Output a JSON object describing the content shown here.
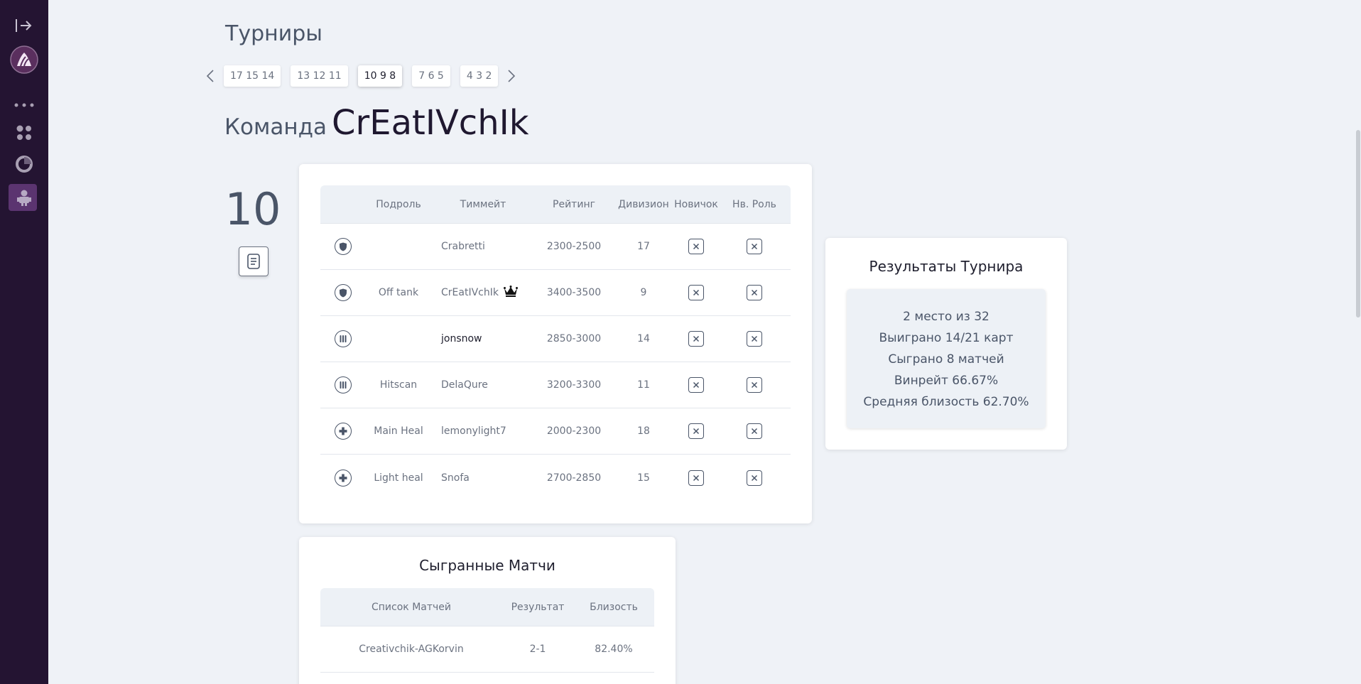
{
  "page": {
    "title": "Турниры"
  },
  "pager": {
    "pages": [
      "17 15 14",
      "13 12 11",
      "10 9 8",
      "7 6 5",
      "4 3 2"
    ],
    "active_index": 2
  },
  "team": {
    "label": "Команда",
    "name": "CrEatIVchIk",
    "number": "10"
  },
  "roster": {
    "headers": {
      "subrole": "Подроль",
      "teammate": "Тиммейт",
      "rating": "Рейтинг",
      "division": "Дивизион",
      "newbie": "Новичок",
      "new_role": "Нв. Роль"
    },
    "rows": [
      {
        "role_icon": "shield-icon",
        "subrole": "",
        "teammate": "Crabretti",
        "rating": "2300-2500",
        "division": "17"
      },
      {
        "role_icon": "shield-icon",
        "subrole": "Off tank",
        "teammate": "CrEatIVchIk",
        "rating": "3400-3500",
        "division": "9",
        "captain": true
      },
      {
        "role_icon": "damage-icon",
        "subrole": "",
        "teammate": "jonsnow",
        "rating": "2850-3000",
        "division": "14"
      },
      {
        "role_icon": "damage-icon",
        "subrole": "Hitscan",
        "teammate": "DelaQure",
        "rating": "3200-3300",
        "division": "11"
      },
      {
        "role_icon": "heal-icon",
        "subrole": "Main Heal",
        "teammate": "lemonylight7",
        "rating": "2000-2300",
        "division": "18"
      },
      {
        "role_icon": "heal-icon",
        "subrole": "Light heal",
        "teammate": "Snofa",
        "rating": "2700-2850",
        "division": "15"
      }
    ]
  },
  "results": {
    "title": "Результаты Турнира",
    "lines": [
      "2 место из 32",
      "Выиграно 14/21 карт",
      "Сыграно 8 матчей",
      "Винрейт 66.67%",
      "Средняя близость 62.70%"
    ]
  },
  "matches": {
    "title": "Сыгранные Матчи",
    "headers": {
      "list": "Список Матчей",
      "result": "Результат",
      "closeness": "Близость"
    },
    "rows": [
      {
        "match": "Creativchik-AGKorvin",
        "result": "2-1",
        "closeness": "82.40%"
      }
    ]
  },
  "colors": {
    "sidebar": "#241432",
    "active_nav": "#5b3470",
    "background": "#eff2f7"
  }
}
